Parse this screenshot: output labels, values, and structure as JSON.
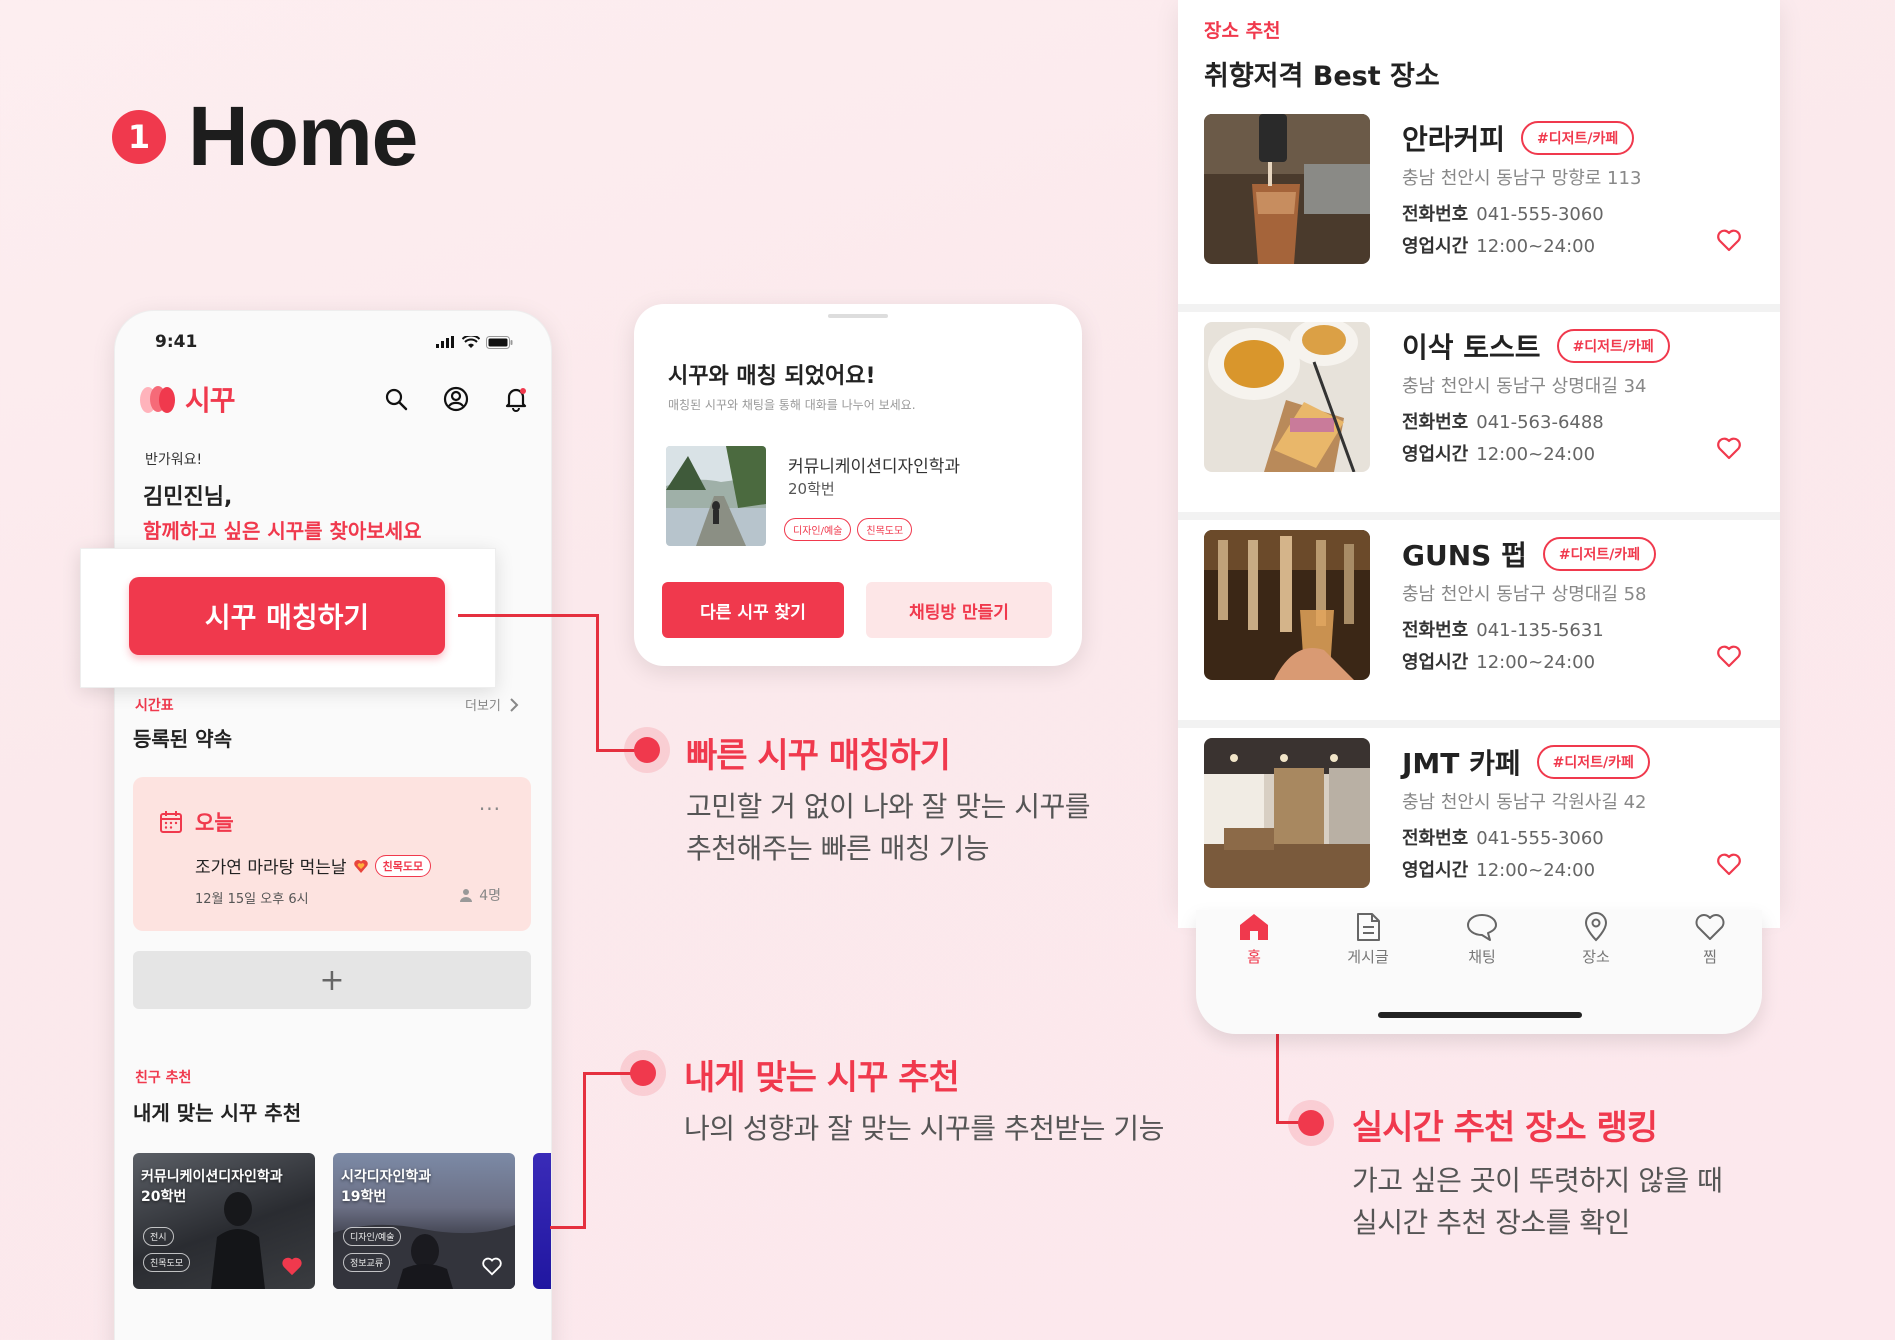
{
  "heading": {
    "number": "1",
    "title": "Home"
  },
  "phone": {
    "status_time": "9:41",
    "logo_text": "시꾸",
    "greeting_small": "반가워요!",
    "greeting_name": "김민진님,",
    "greeting_sub": "함께하고 싶은 시꾸를 찾아보세요",
    "match_button": "시꾸 매칭하기",
    "schedule": {
      "label": "시간표",
      "title": "등록된 약속",
      "more": "더보기"
    },
    "today": {
      "label": "오늘",
      "menu": "···",
      "title": "조가연 마라탕 먹는날",
      "tag": "친목도모",
      "date": "12월 15일 오후 6시",
      "count": "4명"
    },
    "add_button": "+",
    "friends": {
      "label": "친구 추천",
      "title": "내게 맞는 시꾸 추천",
      "cards": [
        {
          "dept": "커뮤니케이션디자인학과",
          "year": "20학번",
          "chip1": "전시",
          "chip2": "친목도모"
        },
        {
          "dept": "시각디자인학과",
          "year": "19학번",
          "chip1": "디자인/예술",
          "chip2": "정보교류"
        }
      ]
    }
  },
  "modal": {
    "title": "시꾸와 매칭 되었어요!",
    "subtitle": "매칭된 시꾸와 채팅을 통해 대화를 나누어 보세요.",
    "dept": "커뮤니케이션디자인학과",
    "year": "20학번",
    "tags": [
      "디자인/예술",
      "친목도모"
    ],
    "btn_find": "다른 시꾸 찾기",
    "btn_chat": "채팅방 만들기"
  },
  "features": [
    {
      "title": "빠른 시꾸 매칭하기",
      "desc1": "고민할 거 없이 나와 잘 맞는 시꾸를",
      "desc2": "추천해주는 빠른 매칭 기능"
    },
    {
      "title": "내게 맞는 시꾸 추천",
      "desc1": "나의 성향과 잘 맞는 시꾸를 추천받는 기능"
    },
    {
      "title": "실시간 추천 장소 랭킹",
      "desc1": "가고 싶은 곳이 뚜렷하지 않을  때",
      "desc2": "실시간 추천 장소를 확인"
    }
  ],
  "places": {
    "label": "장소 추천",
    "title": "취향저격 Best 장소",
    "tel_label": "전화번호",
    "hours_label": "영업시간",
    "items": [
      {
        "name": "안라커피",
        "tag": "#디저트/카페",
        "addr": "충남 천안시 동남구 망향로 113",
        "tel": "041-555-3060",
        "hours": "12:00~24:00"
      },
      {
        "name": "이삭 토스트",
        "tag": "#디저트/카페",
        "addr": "충남 천안시 동남구 상명대길 34",
        "tel": "041-563-6488",
        "hours": "12:00~24:00"
      },
      {
        "name": "GUNS 펍",
        "tag": "#디저트/카페",
        "addr": "충남 천안시 동남구 상명대길 58",
        "tel": "041-135-5631",
        "hours": "12:00~24:00"
      },
      {
        "name": "JMT 카페",
        "tag": "#디저트/카페",
        "addr": "충남 천안시 동남구 각원사길 42",
        "tel": "041-555-3060",
        "hours": "12:00~24:00"
      }
    ]
  },
  "tabbar": [
    {
      "label": "홈",
      "icon": "home-icon",
      "active": true
    },
    {
      "label": "게시글",
      "icon": "document-icon"
    },
    {
      "label": "채팅",
      "icon": "chat-bubble-icon"
    },
    {
      "label": "장소",
      "icon": "location-pin-icon"
    },
    {
      "label": "찜",
      "icon": "heart-icon"
    }
  ],
  "colors": {
    "accent": "#f0394d",
    "accent_light": "#fde3e0"
  }
}
